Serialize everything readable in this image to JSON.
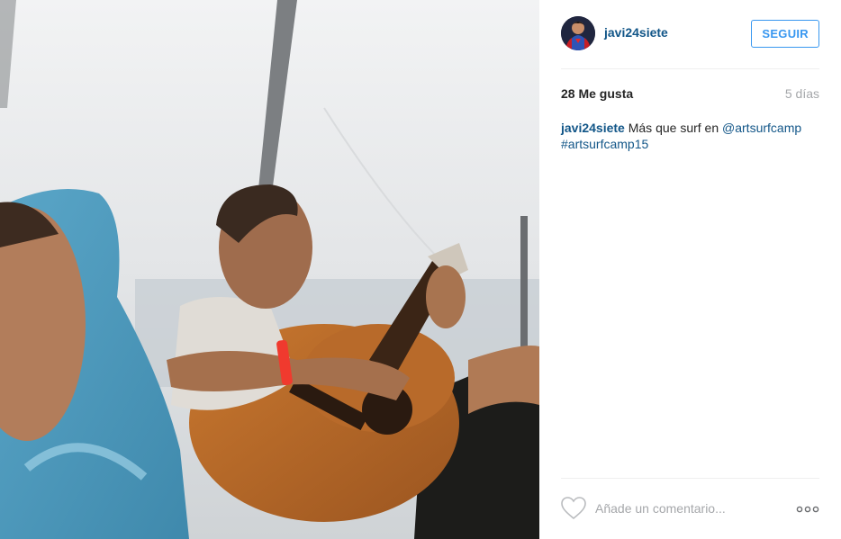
{
  "post": {
    "username": "javi24siete",
    "follow_label": "SEGUIR",
    "likes": "28 Me gusta",
    "age": "5 días",
    "caption": {
      "user": "javi24siete",
      "text": "Más que surf en",
      "mention": "@artsurfcamp",
      "hashtag": "#artsurfcamp15"
    },
    "comment_placeholder": "Añade un comentario..."
  },
  "icons": {
    "avatar": "avatar-image",
    "like": "heart-icon",
    "more": "more-options-icon"
  },
  "colors": {
    "link": "#125688",
    "follow_accent": "#3897f0",
    "muted": "#a5a7aa",
    "text": "#262626"
  }
}
